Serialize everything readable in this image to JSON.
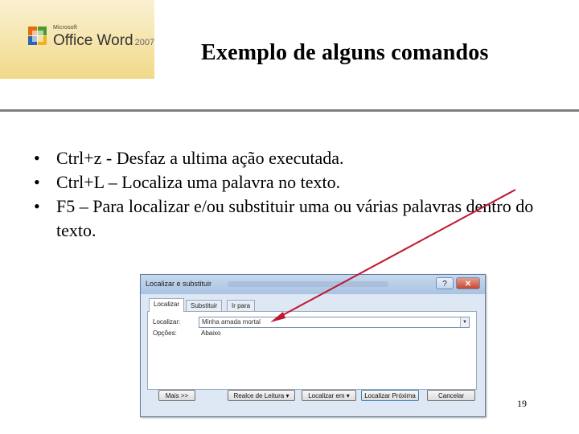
{
  "logo": {
    "brand_small": "Microsoft",
    "product": "Office Word",
    "year": "2007"
  },
  "slide": {
    "title": "Exemplo de alguns comandos",
    "bullets": [
      "Ctrl+z  - Desfaz a ultima ação executada.",
      "Ctrl+L – Localiza uma palavra no texto.",
      "F5 – Para localizar e/ou substituir uma ou várias palavras dentro do texto."
    ],
    "page_number": "19"
  },
  "dialog": {
    "title": "Localizar e substituir",
    "close_label": "✕",
    "help_label": "?",
    "tabs": [
      "Localizar",
      "Substituir",
      "Ir para"
    ],
    "active_tab": 0,
    "find_label": "Localizar:",
    "find_value": "Minha amada mortal",
    "options_label": "Opções:",
    "options_value": "Abaixo",
    "buttons": {
      "more": "Mais >>",
      "reading_highlight": "Realce de Leitura ▾",
      "find_in": "Localizar em ▾",
      "find_next": "Localizar Próxima",
      "cancel": "Cancelar"
    }
  },
  "colors": {
    "arrow": "#c0172f",
    "rule": "#7f7f7f",
    "dialog_bg": "#dde8f4"
  }
}
